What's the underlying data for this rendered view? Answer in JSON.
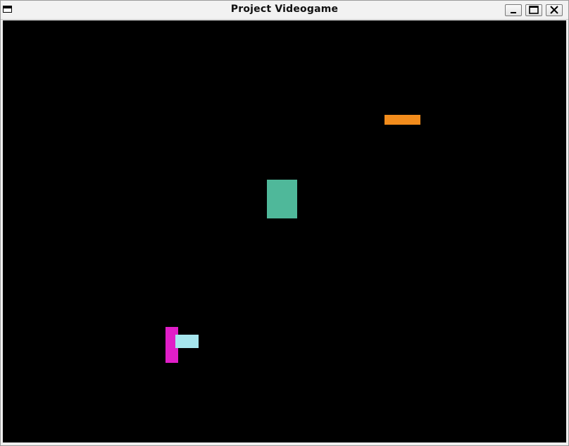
{
  "window": {
    "title": "Project Videogame",
    "controls": {
      "minimize": "minimize-icon",
      "maximize": "maximize-icon",
      "close": "close-icon"
    }
  },
  "game": {
    "background_color": "#000000",
    "objects": [
      {
        "name": "orange-bar",
        "color": "#f28c1c"
      },
      {
        "name": "green-block",
        "color": "#4fb89a"
      },
      {
        "name": "player-body",
        "color": "#e01ec8"
      },
      {
        "name": "player-gun",
        "color": "#a6e6ee"
      }
    ]
  }
}
